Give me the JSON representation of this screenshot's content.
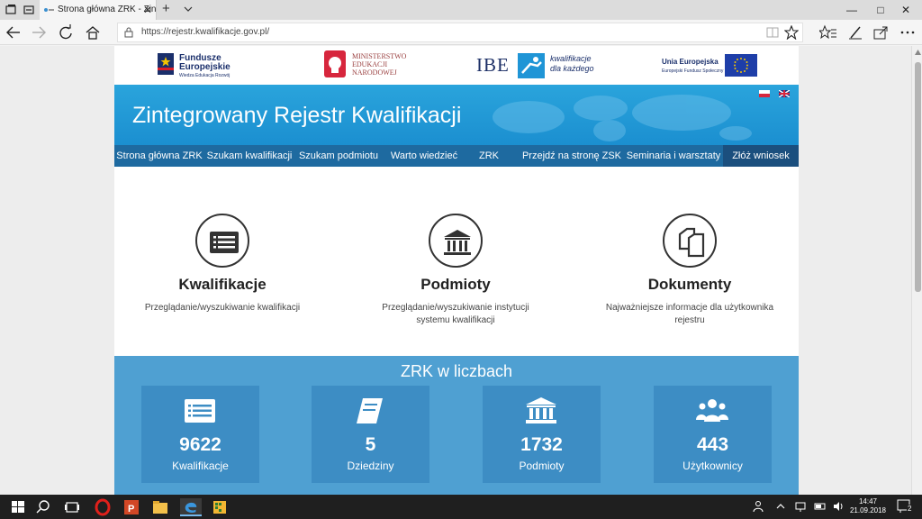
{
  "browser": {
    "tab_title": "Strona główna ZRK - Zin",
    "tab_close": "✕",
    "new_tab": "+",
    "url": "https://rejestr.kwalifikacje.gov.pl/",
    "win_min": "—",
    "win_max": "□",
    "win_close": "✕"
  },
  "logos": {
    "fe_line1": "Fundusze Europejskie",
    "fe_line2": "Wiedza Edukacja Rozwój",
    "men": "MINISTERSTWO EDUKACJI NARODOWEJ",
    "ibe": "IBE",
    "kwalifikacje": "kwalifikacje dla każdego",
    "ue_line1": "Unia Europejska",
    "ue_line2": "Europejski Fundusz Społeczny"
  },
  "hero": {
    "title": "Zintegrowany Rejestr Kwalifikacji"
  },
  "menu": [
    {
      "label": "Strona główna ZRK"
    },
    {
      "label": "Szukam kwalifikacji"
    },
    {
      "label": "Szukam podmiotu"
    },
    {
      "label": "Warto wiedzieć"
    },
    {
      "label": "ZRK"
    },
    {
      "label": "Przejdź na stronę ZSK"
    },
    {
      "label": "Seminaria i warsztaty"
    },
    {
      "label": "Złóż wniosek"
    }
  ],
  "features": [
    {
      "title": "Kwalifikacje",
      "desc": "Przeglądanie/wyszukiwanie kwalifikacji",
      "icon": "list-icon"
    },
    {
      "title": "Podmioty",
      "desc": "Przeglądanie/wyszukiwanie instytucji systemu kwalifikacji",
      "icon": "institution-icon"
    },
    {
      "title": "Dokumenty",
      "desc": "Najważniejsze informacje dla użytkownika rejestru",
      "icon": "documents-icon"
    }
  ],
  "stats": {
    "title": "ZRK w liczbach",
    "items": [
      {
        "value": "9622",
        "label": "Kwalifikacje"
      },
      {
        "value": "5",
        "label": "Dziedziny"
      },
      {
        "value": "1732",
        "label": "Podmioty"
      },
      {
        "value": "443",
        "label": "Użytkownicy"
      }
    ]
  },
  "taskbar": {
    "time": "14:47",
    "date": "21.09.2018",
    "notifications": "2"
  },
  "colors": {
    "hero_blue": "#1b8fd0",
    "menu_blue": "#1e6aa0",
    "stats_blue": "#4fa0d2",
    "stat_box": "#3d8dc4"
  }
}
